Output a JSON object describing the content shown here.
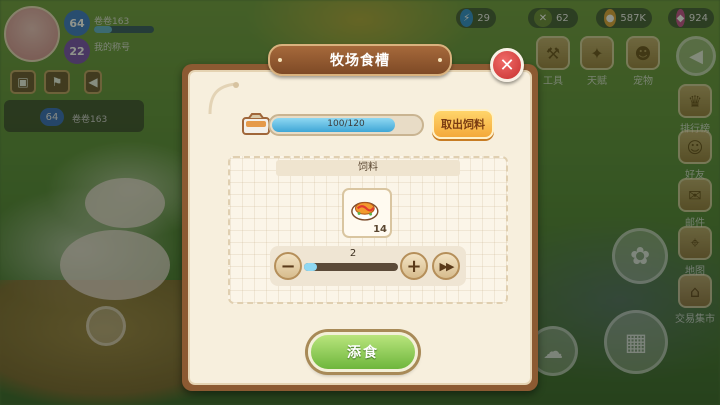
{
  "hud": {
    "player_level": "64",
    "player_secondary_level": "22",
    "player_name": "卷卷163",
    "player_subtitle": "我的称号",
    "pet_level": "64",
    "pet_name": "卷卷163"
  },
  "resources": {
    "energy": "29",
    "tool_count": "62",
    "coins": "587K",
    "gems": "924"
  },
  "side_menu": [
    {
      "label": "工具",
      "icon": "tool-icon"
    },
    {
      "label": "天赋",
      "icon": "talent-icon"
    },
    {
      "label": "宠物",
      "icon": "pet-icon"
    },
    {
      "label": "排行榜",
      "icon": "ranking-icon"
    },
    {
      "label": "好友",
      "icon": "friends-icon"
    },
    {
      "label": "邮件",
      "icon": "mail-icon"
    },
    {
      "label": "地图",
      "icon": "map-icon"
    },
    {
      "label": "交易集市",
      "icon": "market-icon"
    }
  ],
  "dialog": {
    "title": "牧场食槽",
    "close_icon": "close-icon",
    "capacity_text": "100/120",
    "capacity_fraction": 0.833,
    "take_feed_label": "取出饲料",
    "feed_section_title": "饲料",
    "feed_item_icon": "omelette-feed-icon",
    "feed_item_count": "14",
    "quantity": "2",
    "quantity_fraction": 0.143,
    "minus_label": "−",
    "plus_label": "+",
    "max_label": "▶▶",
    "confirm_label": "添食"
  },
  "colors": {
    "dialog_frame": "#8c5a32",
    "dialog_bg": "#f7efdd",
    "confirm_green": "#6eb63c",
    "take_orange": "#f4a93a",
    "close_red": "#c6302f",
    "capacity_blue": "#3fa6d6"
  }
}
